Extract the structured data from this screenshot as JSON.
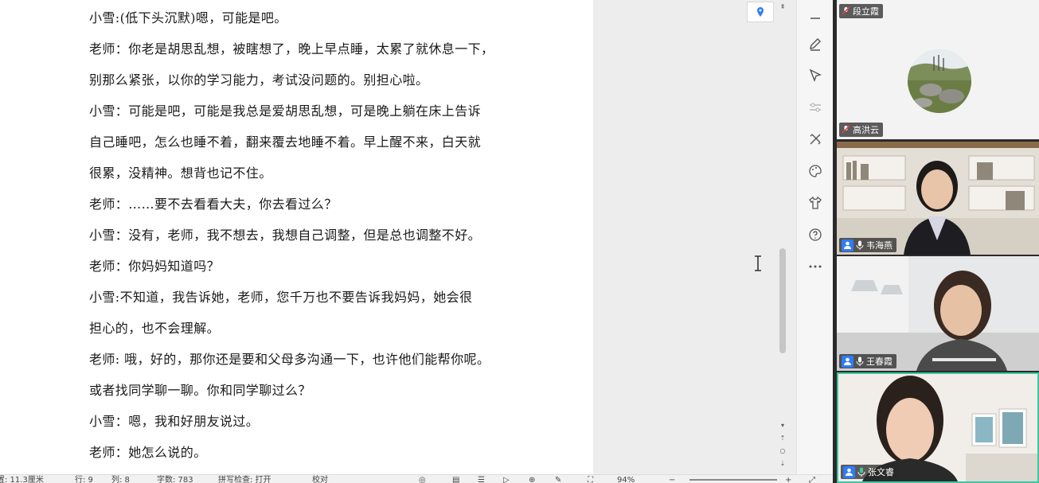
{
  "document": {
    "paragraphs": [
      "小雪:(低下头沉默)嗯，可能是吧。",
      "老师：你老是胡思乱想，被瞎想了，晚上早点睡，太累了就休息一下，",
      "别那么紧张，以你的学习能力，考试没问题的。别担心啦。",
      "小雪：可能是吧，可能是我总是爱胡思乱想，可是晚上躺在床上告诉",
      "自己睡吧，怎么也睡不着，翻来覆去地睡不着。早上醒不来，白天就",
      "很累，没精神。想背也记不住。",
      "老师：……要不去看看大夫，你去看过么？",
      "小雪：没有，老师，我不想去，我想自己调整，但是总也调整不好。",
      "老师：你妈妈知道吗？",
      "小雪:不知道，我告诉她，老师，您千万也不要告诉我妈妈，她会很",
      "担心的，也不会理解。",
      "老师: 哦，好的，那你还是要和父母多沟通一下，也许他们能帮你呢。",
      "或者找同学聊一聊。你和同学聊过么？",
      "小雪：嗯，我和好朋友说过。",
      "老师：她怎么说的。"
    ]
  },
  "statusbar": {
    "position": "置: 11.3厘米",
    "row": "行: 9",
    "col": "列: 8",
    "wordcount": "字数: 783",
    "spellcheck": "拼写检查: 打开",
    "proofread": "校对",
    "zoom": "94%"
  },
  "participants": [
    {
      "name": "段立霞",
      "muted": true
    },
    {
      "name": "高洪云",
      "muted": true
    },
    {
      "name": "韦海燕",
      "muted": false
    },
    {
      "name": "王春霞",
      "muted": false
    },
    {
      "name": "张文睿",
      "muted": false,
      "active": true
    }
  ],
  "colors": {
    "accent": "#2f7cf6",
    "active_border": "#3cc8a0",
    "muted_red": "#e04545"
  }
}
